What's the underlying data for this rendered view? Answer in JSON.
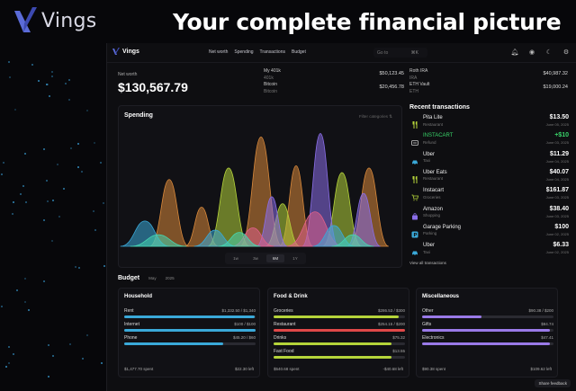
{
  "brand": {
    "name": "Vings",
    "headline": "Your complete financial picture"
  },
  "nav": {
    "logo": "Vings",
    "links": [
      "Net worth",
      "Spending",
      "Transactions",
      "Budget"
    ],
    "search_placeholder": "Go to",
    "search_shortcut": "⌘K",
    "icons": [
      "bell-icon",
      "eye-icon",
      "moon-icon",
      "gear-icon"
    ]
  },
  "net_worth": {
    "label": "Net worth",
    "value": "$130,567.79"
  },
  "accounts": [
    {
      "name": "My 401k",
      "sub": "401k",
      "value": "$50,123.45"
    },
    {
      "name": "Bitcoin",
      "sub": "Bitcoin",
      "value": "$20,456.78"
    },
    {
      "name": "Roth IRA",
      "sub": "IRA",
      "value": "$40,987.32"
    },
    {
      "name": "ETH Vault",
      "sub": "ETH",
      "value": "$19,000.24"
    }
  ],
  "spending": {
    "title": "Spending",
    "filter": "Filter categories",
    "ranges": [
      "1w",
      "3w",
      "6M",
      "1Y"
    ],
    "active_range": "6M"
  },
  "chart_data": {
    "type": "area",
    "title": "Spending",
    "series": [
      {
        "color": "#d9893b",
        "peaks": [
          {
            "x": 0.16,
            "h": 0.58,
            "w": 0.028
          },
          {
            "x": 0.28,
            "h": 0.34,
            "w": 0.024
          },
          {
            "x": 0.5,
            "h": 0.95,
            "w": 0.03
          },
          {
            "x": 0.63,
            "h": 0.7,
            "w": 0.024
          },
          {
            "x": 0.9,
            "h": 0.68,
            "w": 0.028
          }
        ]
      },
      {
        "color": "#b5d43a",
        "peaks": [
          {
            "x": 0.38,
            "h": 0.68,
            "w": 0.03
          },
          {
            "x": 0.58,
            "h": 0.37,
            "w": 0.025
          },
          {
            "x": 0.8,
            "h": 0.64,
            "w": 0.028
          }
        ]
      },
      {
        "color": "#8a6ee8",
        "peaks": [
          {
            "x": 0.54,
            "h": 0.43,
            "w": 0.022
          },
          {
            "x": 0.72,
            "h": 0.98,
            "w": 0.026
          },
          {
            "x": 0.88,
            "h": 0.46,
            "w": 0.024
          }
        ]
      },
      {
        "color": "#e0618a",
        "peaks": [
          {
            "x": 0.7,
            "h": 0.3,
            "w": 0.04
          },
          {
            "x": 0.47,
            "h": 0.16,
            "w": 0.03
          }
        ]
      },
      {
        "color": "#3aa9d9",
        "peaks": [
          {
            "x": 0.07,
            "h": 0.22,
            "w": 0.035
          },
          {
            "x": 0.33,
            "h": 0.14,
            "w": 0.03
          },
          {
            "x": 0.77,
            "h": 0.18,
            "w": 0.03
          }
        ]
      },
      {
        "color": "#46d6b0",
        "peaks": [
          {
            "x": 0.12,
            "h": 0.1,
            "w": 0.04
          },
          {
            "x": 0.42,
            "h": 0.12,
            "w": 0.03
          },
          {
            "x": 0.84,
            "h": 0.1,
            "w": 0.03
          }
        ]
      }
    ]
  },
  "recent": {
    "title": "Recent transactions",
    "view_all": "View all transactions",
    "items": [
      {
        "name": "Pita Lite",
        "category": "Restaurant",
        "amount": "$13.50",
        "date": "June 05, 2025",
        "icon": "fork-knife-icon",
        "positive": false
      },
      {
        "name": "INSTACART",
        "category": "Refund",
        "amount": "+$10",
        "date": "June 03, 2025",
        "icon": "refund-icon",
        "positive": true
      },
      {
        "name": "Uber",
        "category": "Taxi",
        "amount": "$11.29",
        "date": "June 04, 2025",
        "icon": "car-icon",
        "positive": false
      },
      {
        "name": "Uber Eats",
        "category": "Restaurant",
        "amount": "$40.07",
        "date": "June 04, 2025",
        "icon": "fork-knife-icon",
        "positive": false
      },
      {
        "name": "Instacart",
        "category": "Groceries",
        "amount": "$161.87",
        "date": "June 03, 2025",
        "icon": "cart-icon",
        "positive": false
      },
      {
        "name": "Amazon",
        "category": "Shopping",
        "amount": "$38.40",
        "date": "June 03, 2025",
        "icon": "bag-icon",
        "positive": false
      },
      {
        "name": "Garage Parking",
        "category": "Parking",
        "amount": "$100",
        "date": "June 02, 2025",
        "icon": "parking-icon",
        "positive": false
      },
      {
        "name": "Uber",
        "category": "Taxi",
        "amount": "$6.33",
        "date": "June 02, 2025",
        "icon": "car-icon",
        "positive": false
      }
    ]
  },
  "budget": {
    "title": "Budget",
    "month": "May",
    "year": "2025",
    "feedback": "Share feedback",
    "cards": [
      {
        "title": "Household",
        "lines": [
          {
            "name": "Rent",
            "values": "$1,332.50 / $1,340",
            "fill": 0.99,
            "color": "#3aa9d9"
          },
          {
            "name": "Internet",
            "values": "$100 / $100",
            "fill": 1.0,
            "color": "#3aa9d9"
          },
          {
            "name": "Phone",
            "values": "$45.20 / $60",
            "fill": 0.75,
            "color": "#3aa9d9"
          }
        ],
        "spent": "$1,477.70 spent",
        "left": "$22.30 left"
      },
      {
        "title": "Food & Drink",
        "lines": [
          {
            "name": "Groceries",
            "values": "$286.53 / $300",
            "fill": 0.95,
            "color": "#b5d43a"
          },
          {
            "name": "Restaurant",
            "values": "$254.15 / $200",
            "fill": 1.0,
            "color": "#e04848"
          },
          {
            "name": "Drinks",
            "values": "$75.32",
            "fill": 0.9,
            "color": "#b5d43a"
          },
          {
            "name": "Fast Food",
            "values": "$13.55",
            "fill": 0.9,
            "color": "#b5d43a"
          }
        ],
        "spent": "$540.68 spent",
        "left": "-$40.68 left"
      },
      {
        "title": "Miscellaneous",
        "lines": [
          {
            "name": "Other",
            "values": "$90.38 / $200",
            "fill": 0.45,
            "color": "#9a7ae8"
          },
          {
            "name": "Gifts",
            "values": "$84.74",
            "fill": 0.97,
            "color": "#9a7ae8"
          },
          {
            "name": "Electronics",
            "values": "$47.41",
            "fill": 0.97,
            "color": "#9a7ae8"
          }
        ],
        "spent": "$90.38 spent",
        "left": "$109.62 left"
      }
    ]
  }
}
